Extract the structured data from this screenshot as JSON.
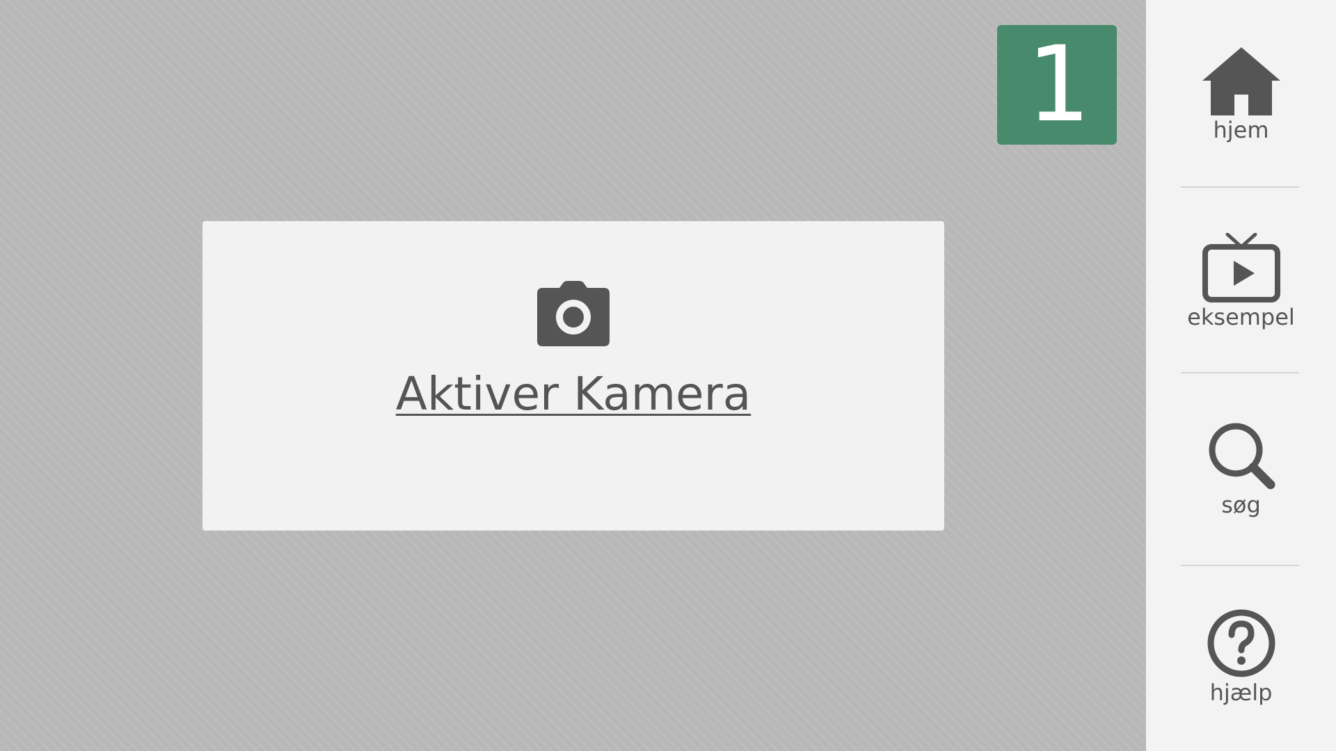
{
  "counter": {
    "value": "1",
    "color": "#488a6c"
  },
  "camera": {
    "icon": "camera-icon",
    "label": "Aktiver Kamera"
  },
  "sidebar": {
    "items": [
      {
        "icon": "home-icon",
        "label": "hjem"
      },
      {
        "icon": "tv-play-icon",
        "label": "eksempel"
      },
      {
        "icon": "search-icon",
        "label": "søg"
      },
      {
        "icon": "question-circle-icon",
        "label": "hjælp"
      }
    ]
  },
  "colors": {
    "icon": "#555555",
    "sidebar_bg": "#f3f3f3",
    "card_bg": "#f2f2f2",
    "main_bg": "#b8b8b8"
  }
}
